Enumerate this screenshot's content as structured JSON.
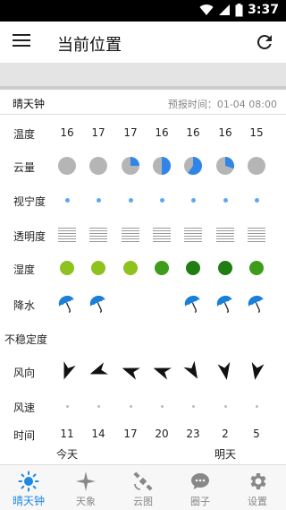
{
  "status_bar": {
    "time": "3:37"
  },
  "app_bar": {
    "title": "当前位置"
  },
  "forecast_header": {
    "title": "晴天钟",
    "forecast_time": "预报时间：01-04 08:00"
  },
  "row_labels": {
    "temperature": "温度",
    "cloud_cover": "云量",
    "seeing": "视宁度",
    "transparency": "透明度",
    "humidity": "湿度",
    "precipitation": "降水",
    "instability": "不稳定度",
    "wind_direction": "风向",
    "wind_speed": "风速",
    "time": "时间"
  },
  "columns": [
    {
      "temp": "16",
      "cloud": 0,
      "precip": true,
      "humidity_color": "#8dc21f",
      "wind_dir_deg": 200,
      "hour": "11"
    },
    {
      "temp": "17",
      "cloud": 0,
      "precip": true,
      "humidity_color": "#8dc21f",
      "wind_dir_deg": 250,
      "hour": "14"
    },
    {
      "temp": "17",
      "cloud": 0.25,
      "precip": false,
      "humidity_color": "#8dc21f",
      "wind_dir_deg": 290,
      "hour": "17"
    },
    {
      "temp": "16",
      "cloud": 0.5,
      "precip": false,
      "humidity_color": "#3f9c1a",
      "wind_dir_deg": 290,
      "hour": "20"
    },
    {
      "temp": "16",
      "cloud": 0.6,
      "precip": true,
      "humidity_color": "#1f7d12",
      "wind_dir_deg": 150,
      "hour": "23"
    },
    {
      "temp": "16",
      "cloud": 0.3,
      "precip": true,
      "humidity_color": "#1f7d12",
      "wind_dir_deg": 170,
      "hour": "2"
    },
    {
      "temp": "15",
      "cloud": 0,
      "precip": true,
      "humidity_color": "#3f9c1a",
      "wind_dir_deg": 190,
      "hour": "5"
    }
  ],
  "day_labels": {
    "today": "今天",
    "tomorrow": "明天"
  },
  "tabs": [
    {
      "label": "晴天钟",
      "icon": "sun-icon",
      "active": true
    },
    {
      "label": "天象",
      "icon": "star-icon",
      "active": false
    },
    {
      "label": "云图",
      "icon": "satellite-icon",
      "active": false
    },
    {
      "label": "圈子",
      "icon": "chat-icon",
      "active": false
    },
    {
      "label": "设置",
      "icon": "gear-icon",
      "active": false
    }
  ],
  "colors": {
    "accent": "#1e88e5",
    "cloud_gray": "#b5b5b5",
    "cloud_blue": "#2f86e8",
    "dot_blue": "#5fa7ef",
    "umbrella_blue": "#1a7fd9"
  }
}
